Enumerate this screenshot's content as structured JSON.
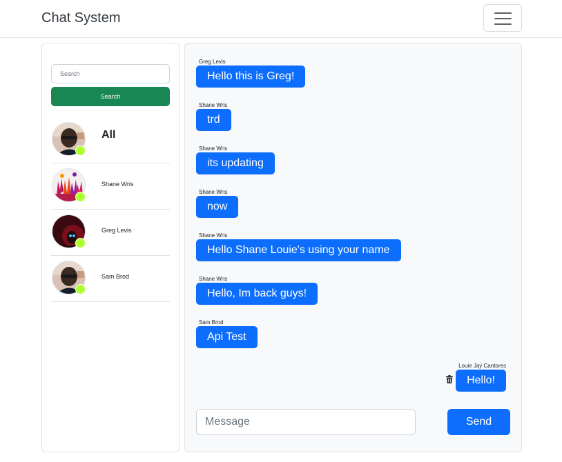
{
  "navbar": {
    "brand": "Chat System",
    "toggler_icon": "hamburger-menu-icon"
  },
  "sidebar": {
    "search_placeholder": "Search",
    "search_button": "Search",
    "contacts": [
      {
        "name": "All",
        "online": true,
        "online_color": "#adff2f"
      },
      {
        "name": "Shane Wris",
        "online": true,
        "online_color": "#adff2f"
      },
      {
        "name": "Greg Levis",
        "online": true,
        "online_color": "#adff2f"
      },
      {
        "name": "Sam Brod",
        "online": true,
        "online_color": "#adff2f"
      }
    ]
  },
  "chat": {
    "messages": [
      {
        "sender": "Greg Levis",
        "text": "Hello this is Greg!"
      },
      {
        "sender": "Shane Wris",
        "text": "trd"
      },
      {
        "sender": "Shane Wris",
        "text": "its updating"
      },
      {
        "sender": "Shane Wris",
        "text": "now"
      },
      {
        "sender": "Shane Wris",
        "text": "Hello Shane Louie's using your name"
      },
      {
        "sender": "Shane Wris",
        "text": "Hello, Im back guys!"
      },
      {
        "sender": "Sam Brod",
        "text": "Api Test"
      }
    ],
    "own_message": {
      "sender": "Louie Jay Cantores",
      "text": "Hello!",
      "delete_icon": "trash-icon"
    },
    "input_placeholder": "Message",
    "send_label": "Send"
  },
  "colors": {
    "primary": "#0d6efd",
    "success": "#198754",
    "online": "#adff2f",
    "panel_bg": "#f8f9fa"
  }
}
